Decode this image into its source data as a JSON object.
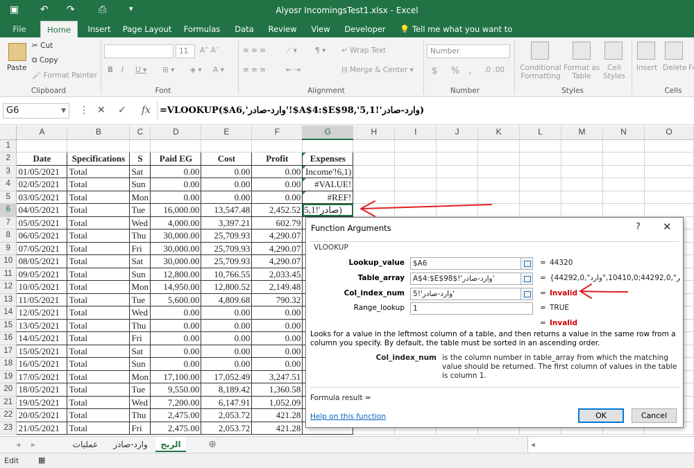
{
  "window": {
    "title": "Alyosr IncomingsTest1.xlsx  -  Excel"
  },
  "tabs": [
    "File",
    "Home",
    "Insert",
    "Page Layout",
    "Formulas",
    "Data",
    "Review",
    "View",
    "Developer"
  ],
  "tell_me": "Tell me what you want to do...",
  "ribbon": {
    "clipboard": {
      "label": "Clipboard",
      "paste": "Paste",
      "cut": "Cut",
      "copy": "Copy",
      "format_painter": "Format Painter"
    },
    "font": {
      "label": "Font",
      "size": "11"
    },
    "alignment": {
      "label": "Alignment",
      "wrap_text": "Wrap Text",
      "merge_center": "Merge & Center"
    },
    "number": {
      "label": "Number",
      "format": "Number",
      "currency": "$",
      "percent": "%",
      "comma": ","
    },
    "styles": {
      "label": "Styles",
      "conditional": "Conditional",
      "formatting": "Formatting",
      "format_as": "Format as",
      "table": "Table",
      "cell": "Cell",
      "cell_styles": "Styles"
    },
    "cells": {
      "label": "Cells",
      "insert": "Insert",
      "delete": "Delete",
      "format": "Fo"
    }
  },
  "formula_bar": {
    "name_box": "G6",
    "formula": "=VLOOKUP($A6,'وارد-صادر'!$A$4:$E$98,'وارد-صادر'!5,1)"
  },
  "columns": [
    "A",
    "B",
    "C",
    "D",
    "E",
    "F",
    "G",
    "H",
    "I",
    "J",
    "K",
    "L",
    "M",
    "N",
    "O"
  ],
  "rows": [
    {
      "n": "1",
      "cells": [
        "",
        "",
        "",
        "",
        "",
        "",
        ""
      ]
    },
    {
      "n": "2",
      "cells": [
        "Date",
        "Specifications",
        "S",
        "Paid EG",
        "Cost",
        "Profit",
        "Expenses"
      ]
    },
    {
      "n": "3",
      "cells": [
        "01/05/2021",
        "Total",
        "Sat",
        "0.00",
        "0.00",
        "0.00",
        "Income'!6,1)"
      ]
    },
    {
      "n": "4",
      "cells": [
        "02/05/2021",
        "Total",
        "Sun",
        "0.00",
        "0.00",
        "0.00",
        "#VALUE!"
      ]
    },
    {
      "n": "5",
      "cells": [
        "03/05/2021",
        "Total",
        "Mon",
        "0.00",
        "0.00",
        "0.00",
        "#REF!"
      ]
    },
    {
      "n": "6",
      "cells": [
        "04/05/2021",
        "Total",
        "Tue",
        "16,000.00",
        "13,547.48",
        "2,452.52",
        "صادر'!5,1)"
      ]
    },
    {
      "n": "7",
      "cells": [
        "05/05/2021",
        "Total",
        "Wed",
        "4,000.00",
        "3,397.21",
        "602.79",
        ""
      ]
    },
    {
      "n": "8",
      "cells": [
        "06/05/2021",
        "Total",
        "Thu",
        "30,000.00",
        "25,709.93",
        "4,290.07",
        ""
      ]
    },
    {
      "n": "9",
      "cells": [
        "07/05/2021",
        "Total",
        "Fri",
        "30,000.00",
        "25,709.93",
        "4,290.07",
        ""
      ]
    },
    {
      "n": "10",
      "cells": [
        "08/05/2021",
        "Total",
        "Sat",
        "30,000.00",
        "25,709.93",
        "4,290.07",
        ""
      ]
    },
    {
      "n": "11",
      "cells": [
        "09/05/2021",
        "Total",
        "Sun",
        "12,800.00",
        "10,766.55",
        "2,033.45",
        ""
      ]
    },
    {
      "n": "12",
      "cells": [
        "10/05/2021",
        "Total",
        "Mon",
        "14,950.00",
        "12,800.52",
        "2,149.48",
        ""
      ]
    },
    {
      "n": "13",
      "cells": [
        "11/05/2021",
        "Total",
        "Tue",
        "5,600.00",
        "4,809.68",
        "790.32",
        ""
      ]
    },
    {
      "n": "14",
      "cells": [
        "12/05/2021",
        "Total",
        "Wed",
        "0.00",
        "0.00",
        "0.00",
        ""
      ]
    },
    {
      "n": "15",
      "cells": [
        "13/05/2021",
        "Total",
        "Thu",
        "0.00",
        "0.00",
        "0.00",
        ""
      ]
    },
    {
      "n": "16",
      "cells": [
        "14/05/2021",
        "Total",
        "Fri",
        "0.00",
        "0.00",
        "0.00",
        ""
      ]
    },
    {
      "n": "17",
      "cells": [
        "15/05/2021",
        "Total",
        "Sat",
        "0.00",
        "0.00",
        "0.00",
        ""
      ]
    },
    {
      "n": "18",
      "cells": [
        "16/05/2021",
        "Total",
        "Sun",
        "0.00",
        "0.00",
        "0.00",
        ""
      ]
    },
    {
      "n": "19",
      "cells": [
        "17/05/2021",
        "Total",
        "Mon",
        "17,100.00",
        "17,052.49",
        "3,247.51",
        ""
      ]
    },
    {
      "n": "20",
      "cells": [
        "18/05/2021",
        "Total",
        "Tue",
        "9,550.00",
        "8,189.42",
        "1,360.58",
        ""
      ]
    },
    {
      "n": "21",
      "cells": [
        "19/05/2021",
        "Total",
        "Wed",
        "7,200.00",
        "6,147.91",
        "1,052.09",
        ""
      ]
    },
    {
      "n": "22",
      "cells": [
        "20/05/2021",
        "Total",
        "Thu",
        "2,475.00",
        "2,053.72",
        "421.28",
        ""
      ]
    },
    {
      "n": "23",
      "cells": [
        "21/05/2021",
        "Total",
        "Fri",
        "2,475.00",
        "2,053.72",
        "421.28",
        ""
      ]
    }
  ],
  "sheet_tabs": [
    "عمليات",
    "وارد-صادر",
    "الربح"
  ],
  "active_sheet": "الربح",
  "status": {
    "mode": "Edit"
  },
  "dialog": {
    "title": "Function Arguments",
    "help_glyph": "?",
    "close_glyph": "✕",
    "function": "VLOOKUP",
    "args": [
      {
        "label": "Lookup_value",
        "input": "$A6",
        "eq": "=",
        "value": "44320"
      },
      {
        "label": "Table_array",
        "input": "'وارد-صادر'!$A$4:$E$98",
        "eq": "=",
        "value": "{44292,0,\"غير\",44292,0;10410,0,\"وارد\"..."
      },
      {
        "label": "Col_index_num",
        "input": "'وارد-صادر'!5",
        "eq": "=",
        "value": "Invalid"
      },
      {
        "label": "Range_lookup",
        "input": "1",
        "eq": "=",
        "value": "TRUE"
      }
    ],
    "overall_eq": "=",
    "overall_value": "Invalid",
    "description": "Looks for a value in the leftmost column of a table, and then returns a value in the same row from a column you specify. By default, the table must be sorted in an ascending order.",
    "arg_desc_label": "Col_index_num",
    "arg_desc": "is the column number in table_array from which the matching value should be returned. The first column of values in the table is column 1.",
    "formula_result": "Formula result =",
    "help_link": "Help on this function",
    "ok": "OK",
    "cancel": "Cancel"
  },
  "colors": {
    "excel_green": "#217346",
    "invalid_red": "#d00000",
    "annotation_red": "#e02020"
  }
}
